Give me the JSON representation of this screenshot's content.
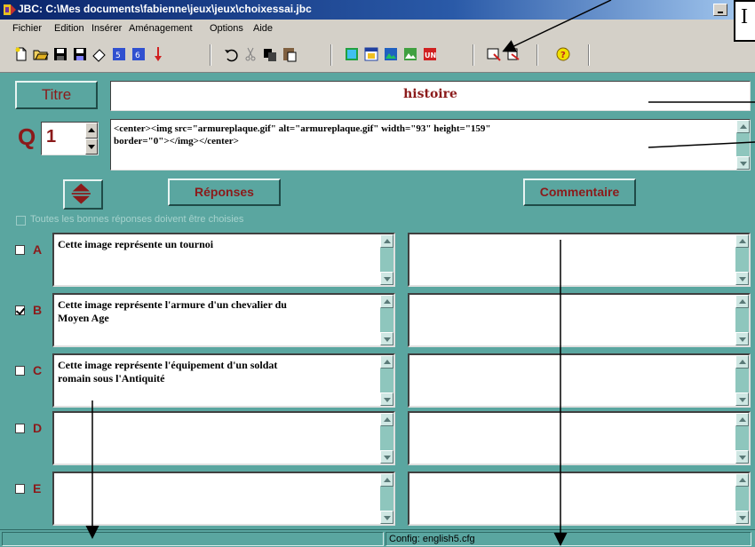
{
  "window": {
    "title": "JBC: C:\\Mes documents\\fabienne\\jeux\\jeux\\choixessai.jbc"
  },
  "menu": [
    "Fichier",
    "Edition",
    "Insérer",
    "Aménagement",
    "Options",
    "Aide"
  ],
  "note_box": {
    "text": "I"
  },
  "title_button": "Titre",
  "title_value": "histoire",
  "question": {
    "label": "Q",
    "number": "1",
    "html_line1": "<center><img src=\"armureplaque.gif\" alt=\"armureplaque.gif\" width=\"93\" height=\"159\"",
    "html_line2": "border=\"0\"></img></center>"
  },
  "responses_button": "Réponses",
  "comment_button": "Commentaire",
  "all_correct_label": "Toutes les bonnes réponses doivent être choisies",
  "answers": [
    {
      "letter": "A",
      "checked": false,
      "line1": "Cette image représente un tournoi",
      "line2": ""
    },
    {
      "letter": "B",
      "checked": true,
      "line1": "Cette image représente l'armure d'un chevalier du",
      "line2": "Moyen Age"
    },
    {
      "letter": "C",
      "checked": false,
      "line1": "Cette image représente l'équipement d'un soldat",
      "line2": "romain sous l'Antiquité"
    },
    {
      "letter": "D",
      "checked": false,
      "line1": "",
      "line2": ""
    },
    {
      "letter": "E",
      "checked": false,
      "line1": "",
      "line2": ""
    }
  ],
  "status": {
    "config": "Config: english5.cfg"
  },
  "colors": {
    "window_bg": "#5aa6a0",
    "accent_text": "#8b1a1a",
    "title_gradient_start": "#0a246a"
  },
  "toolbar_icons": [
    "new-icon",
    "open-icon",
    "save-icon",
    "save-as-icon",
    "eraser-icon",
    "export-icon",
    "export-all-icon",
    "down-arrow-icon",
    "undo-icon",
    "cut-icon",
    "copy-icon",
    "paste-icon",
    "image-icon",
    "window-icon",
    "image2-icon",
    "image3-icon",
    "un-icon",
    "tool1-icon",
    "tool2-icon",
    "help-icon"
  ]
}
